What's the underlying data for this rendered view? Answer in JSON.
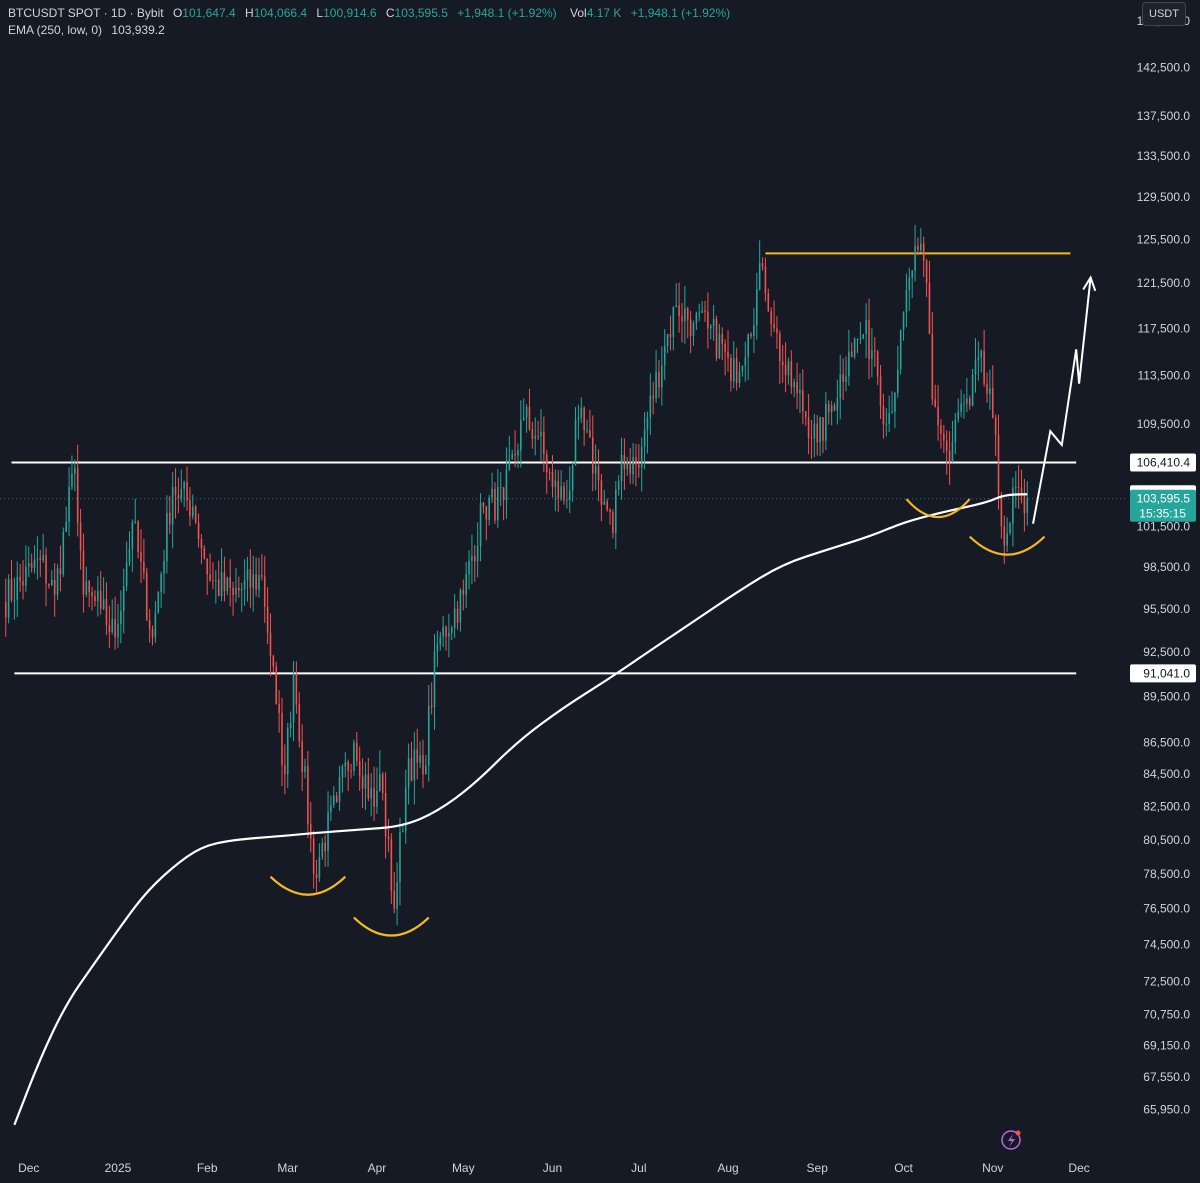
{
  "legend": {
    "symbol": "BTCUSDT SPOT · 1D · Bybit",
    "open_label": "O",
    "open": "101,647.4",
    "high_label": "H",
    "high": "104,066.4",
    "low_label": "L",
    "low": "100,914.6",
    "close_label": "C",
    "close": "103,595.5",
    "change": "+1,948.1 (+1.92%)",
    "vol_label": "Vol",
    "vol": "4.17 K",
    "vol_change": "+1,948.1 (+1.92%)",
    "ema_label": "EMA (250, low, 0)",
    "ema_value": "103,939.2"
  },
  "currency_button": "USDT",
  "colors": {
    "background": "#161a25",
    "up": "#26a69a",
    "down": "#ef5350",
    "ema": "#ffffff",
    "resistance": "#f5b91e",
    "arc": "#f5b91e",
    "level": "#ffffff"
  },
  "chart_data": {
    "type": "candlestick",
    "scale": "log",
    "y_ticks": [
      147500,
      142500,
      137500,
      133500,
      129500,
      125500,
      121500,
      117500,
      113500,
      109500,
      101500,
      98500,
      95500,
      92500,
      89500,
      86500,
      84500,
      82500,
      80500,
      78500,
      76500,
      74500,
      72500,
      70750,
      69150,
      67550,
      65950
    ],
    "y_tick_labels": [
      "147,500.0",
      "142,500.0",
      "137,500.0",
      "133,500.0",
      "129,500.0",
      "125,500.0",
      "121,500.0",
      "117,500.0",
      "113,500.0",
      "109,500.0",
      "101,500.0",
      "98,500.0",
      "95,500.0",
      "92,500.0",
      "89,500.0",
      "86,500.0",
      "84,500.0",
      "82,500.0",
      "80,500.0",
      "78,500.0",
      "76,500.0",
      "74,500.0",
      "72,500.0",
      "70,750.0",
      "69,150.0",
      "67,550.0",
      "65,950.0"
    ],
    "x_labels": [
      "Dec",
      "2025",
      "Feb",
      "Mar",
      "Apr",
      "May",
      "Jun",
      "Jul",
      "Aug",
      "Sep",
      "Oct",
      "Nov",
      "Dec"
    ],
    "x_label_dates": [
      "2024-12-01",
      "2025-01-01",
      "2025-02-01",
      "2025-03-01",
      "2025-04-01",
      "2025-05-01",
      "2025-06-01",
      "2025-07-01",
      "2025-08-01",
      "2025-09-01",
      "2025-10-01",
      "2025-11-01",
      "2025-12-01"
    ],
    "price_line_labels": [
      {
        "value": 106410.4,
        "label": "106,410.4",
        "style": "level"
      },
      {
        "value": 103939.2,
        "label": "103,939.2",
        "style": "ema"
      },
      {
        "value": 103595.5,
        "label": "103,595.5",
        "style": "last"
      },
      {
        "value": 91041.0,
        "label": "91,041.0",
        "style": "level"
      }
    ],
    "countdown": "15:35:15",
    "horizontal_levels": [
      {
        "value": 106410.4,
        "from": "2024-11-25",
        "to": "2025-11-30"
      },
      {
        "value": 91041.0,
        "from": "2024-11-26",
        "to": "2025-11-30"
      },
      {
        "value": 124200,
        "from": "2025-08-14",
        "to": "2025-11-28",
        "style": "resistance"
      }
    ],
    "anchors": [
      [
        "2024-11-22",
        96000
      ],
      [
        "2024-12-05",
        99000
      ],
      [
        "2024-12-10",
        96500
      ],
      [
        "2024-12-17",
        106000
      ],
      [
        "2024-12-20",
        96500
      ],
      [
        "2024-12-26",
        95500
      ],
      [
        "2024-12-31",
        93500
      ],
      [
        "2025-01-06",
        101800
      ],
      [
        "2025-01-13",
        93500
      ],
      [
        "2025-01-20",
        104500
      ],
      [
        "2025-01-27",
        103000
      ],
      [
        "2025-02-02",
        97500
      ],
      [
        "2025-02-10",
        96500
      ],
      [
        "2025-02-20",
        97800
      ],
      [
        "2025-02-25",
        89000
      ],
      [
        "2025-02-28",
        84500
      ],
      [
        "2025-03-03",
        91000
      ],
      [
        "2025-03-10",
        78500
      ],
      [
        "2025-03-18",
        82800
      ],
      [
        "2025-03-24",
        86500
      ],
      [
        "2025-03-31",
        82500
      ],
      [
        "2025-04-02",
        84500
      ],
      [
        "2025-04-07",
        76500
      ],
      [
        "2025-04-12",
        85500
      ],
      [
        "2025-04-17",
        84500
      ],
      [
        "2025-04-22",
        93000
      ],
      [
        "2025-05-01",
        96500
      ],
      [
        "2025-05-08",
        103000
      ],
      [
        "2025-05-15",
        103500
      ],
      [
        "2025-05-22",
        110000
      ],
      [
        "2025-05-27",
        108500
      ],
      [
        "2025-06-01",
        104500
      ],
      [
        "2025-06-06",
        103500
      ],
      [
        "2025-06-10",
        110000
      ],
      [
        "2025-06-17",
        105000
      ],
      [
        "2025-06-22",
        101000
      ],
      [
        "2025-06-25",
        107000
      ],
      [
        "2025-07-01",
        106000
      ],
      [
        "2025-07-03",
        109000
      ],
      [
        "2025-07-10",
        116000
      ],
      [
        "2025-07-14",
        119500
      ],
      [
        "2025-07-20",
        118000
      ],
      [
        "2025-07-25",
        117500
      ],
      [
        "2025-07-31",
        115500
      ],
      [
        "2025-08-02",
        113000
      ],
      [
        "2025-08-08",
        117000
      ],
      [
        "2025-08-13",
        123000
      ],
      [
        "2025-08-17",
        117500
      ],
      [
        "2025-08-21",
        113500
      ],
      [
        "2025-08-25",
        112000
      ],
      [
        "2025-09-01",
        108000
      ],
      [
        "2025-09-06",
        111000
      ],
      [
        "2025-09-12",
        115500
      ],
      [
        "2025-09-17",
        117000
      ],
      [
        "2025-09-21",
        115500
      ],
      [
        "2025-09-25",
        109500
      ],
      [
        "2025-09-29",
        114000
      ],
      [
        "2025-10-03",
        122000
      ],
      [
        "2025-10-06",
        124500
      ],
      [
        "2025-10-09",
        121500
      ],
      [
        "2025-10-11",
        111500
      ],
      [
        "2025-10-17",
        106500
      ],
      [
        "2025-10-20",
        110500
      ],
      [
        "2025-10-24",
        111000
      ],
      [
        "2025-10-27",
        115000
      ],
      [
        "2025-11-01",
        110000
      ],
      [
        "2025-11-04",
        101500
      ],
      [
        "2025-11-06",
        101000
      ],
      [
        "2025-11-09",
        104500
      ],
      [
        "2025-11-12",
        102500
      ],
      [
        "2025-11-13",
        103596
      ]
    ],
    "ema_path": [
      [
        "2024-11-26",
        65200
      ],
      [
        "2024-12-05",
        68500
      ],
      [
        "2024-12-14",
        71300
      ],
      [
        "2024-12-23",
        73300
      ],
      [
        "2025-01-01",
        75300
      ],
      [
        "2025-01-10",
        77300
      ],
      [
        "2025-01-20",
        78900
      ],
      [
        "2025-01-30",
        80100
      ],
      [
        "2025-02-10",
        80500
      ],
      [
        "2025-02-25",
        80700
      ],
      [
        "2025-03-10",
        80900
      ],
      [
        "2025-03-25",
        81100
      ],
      [
        "2025-04-10",
        81300
      ],
      [
        "2025-04-22",
        82200
      ],
      [
        "2025-05-05",
        83900
      ],
      [
        "2025-05-20",
        86600
      ],
      [
        "2025-06-05",
        88800
      ],
      [
        "2025-06-20",
        90600
      ],
      [
        "2025-07-05",
        92600
      ],
      [
        "2025-07-20",
        94600
      ],
      [
        "2025-08-05",
        96800
      ],
      [
        "2025-08-20",
        98700
      ],
      [
        "2025-09-05",
        99800
      ],
      [
        "2025-09-20",
        100800
      ],
      [
        "2025-10-01",
        101800
      ],
      [
        "2025-10-15",
        102600
      ],
      [
        "2025-10-30",
        103300
      ],
      [
        "2025-11-05",
        103900
      ],
      [
        "2025-11-13",
        103939
      ]
    ],
    "projection": [
      [
        "2025-11-15",
        101700
      ],
      [
        "2025-11-21",
        108900
      ],
      [
        "2025-11-25",
        107800
      ],
      [
        "2025-11-30",
        115700
      ],
      [
        "2025-12-01",
        112800
      ],
      [
        "2025-12-05",
        122000
      ]
    ],
    "arcs": [
      {
        "center": [
          "2025-03-08",
          77300
        ],
        "half_width_days": 13,
        "depth": 900
      },
      {
        "center": [
          "2025-04-06",
          75000
        ],
        "half_width_days": 13,
        "depth": 900
      },
      {
        "center": [
          "2025-10-13",
          102200
        ],
        "half_width_days": 11,
        "depth": 900
      },
      {
        "center": [
          "2025-11-06",
          99400
        ],
        "half_width_days": 13,
        "depth": 900
      }
    ],
    "visible_range": {
      "from": "2024-11-21",
      "to": "2025-12-18"
    },
    "ylim": [
      64000,
      149800
    ]
  }
}
